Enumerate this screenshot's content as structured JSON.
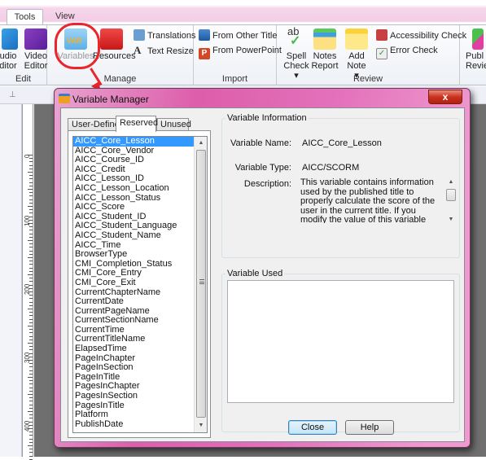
{
  "ribbon": {
    "tabs": [
      {
        "label": "Tools",
        "active": true
      },
      {
        "label": "View",
        "active": false
      }
    ],
    "groups": {
      "edit": {
        "label": "Edit",
        "buttons": [
          {
            "line1": "udio",
            "line2": "ditor",
            "icon": "audio-editor-icon"
          },
          {
            "line1": "Video",
            "line2": "Editor",
            "icon": "video-editor-icon"
          }
        ]
      },
      "manage": {
        "label": "Manage",
        "variables": {
          "label": "Variables",
          "icon": "variables-icon"
        },
        "resources": {
          "label": "Resources",
          "icon": "resources-icon"
        },
        "translations": {
          "label": "Translations",
          "icon": "translations-icon"
        },
        "text_resize": {
          "label": "Text Resize",
          "icon": "text-resize-icon"
        }
      },
      "import": {
        "label": "Import",
        "from_other_title": {
          "label": "From Other Title",
          "icon": "book-icon"
        },
        "from_powerpoint": {
          "label": "From PowerPoint",
          "icon": "powerpoint-icon"
        }
      },
      "review": {
        "label": "Review",
        "spell_check": {
          "line1": "Spell",
          "line2": "Check",
          "icon": "spell-check-icon"
        },
        "notes_report": {
          "line1": "Notes",
          "line2": "Report",
          "icon": "notes-report-icon"
        },
        "add_note": {
          "line1": "Add Note",
          "icon": "add-note-icon"
        },
        "accessibility_check": {
          "label": "Accessibility Check",
          "icon": "accessibility-check-icon"
        },
        "error_check": {
          "label": "Error Check",
          "icon": "error-check-icon"
        }
      },
      "publish": {
        "line1": "Publ",
        "line2": "Revie",
        "icon": "publish-review-icon"
      }
    }
  },
  "ruler": {
    "labels": [
      "0",
      "100",
      "200",
      "300",
      "400"
    ]
  },
  "dialog": {
    "title": "Variable Manager",
    "close_glyph": "x",
    "tabs": [
      {
        "label": "User-Defined",
        "selected": false
      },
      {
        "label": "Reserved",
        "selected": true
      },
      {
        "label": "Unused",
        "selected": false
      }
    ],
    "variables": [
      "AICC_Core_Lesson",
      "AICC_Core_Vendor",
      "AICC_Course_ID",
      "AICC_Credit",
      "AICC_Lesson_ID",
      "AICC_Lesson_Location",
      "AICC_Lesson_Status",
      "AICC_Score",
      "AICC_Student_ID",
      "AICC_Student_Language",
      "AICC_Student_Name",
      "AICC_Time",
      "BrowserType",
      "CMI_Completion_Status",
      "CMI_Core_Entry",
      "CMI_Core_Exit",
      "CurrentChapterName",
      "CurrentDate",
      "CurrentPageName",
      "CurrentSectionName",
      "CurrentTime",
      "CurrentTitleName",
      "ElapsedTime",
      "PageInChapter",
      "PageInSection",
      "PageInTitle",
      "PagesInChapter",
      "PagesInSection",
      "PagesInTitle",
      "Platform",
      "PublishDate"
    ],
    "selected_variable": "AICC_Core_Lesson",
    "info": {
      "legend": "Variable Information",
      "name_label": "Variable Name:",
      "name_value": "AICC_Core_Lesson",
      "type_label": "Variable Type:",
      "type_value": "AICC/SCORM",
      "desc_label": "Description:",
      "desc_value": "This variable contains information used by the published title to properly calculate the score of the user in the current title. If you modify the value of this variable within the content of a title that contains more than"
    },
    "used": {
      "legend": "Variable Used"
    },
    "buttons": {
      "close": "Close",
      "help": "Help"
    }
  }
}
